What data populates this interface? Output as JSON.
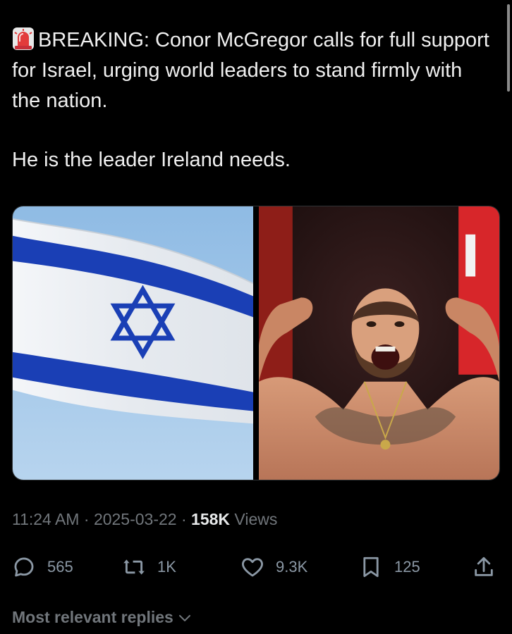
{
  "tweet": {
    "line1": "BREAKING: Conor McGregor calls for full support for Israel, urging world leaders to stand firmly with the nation.",
    "line2": "He is the leader Ireland needs."
  },
  "meta": {
    "time": "11:24 AM",
    "sep1": " · ",
    "date": "2025-03-22",
    "sep2": " · ",
    "views_count": "158K",
    "views_label": " Views"
  },
  "actions": {
    "replies": "565",
    "reposts": "1K",
    "likes": "9.3K",
    "bookmarks": "125"
  },
  "replies_sort": {
    "label": "Most relevant replies"
  },
  "icons": [
    "siren-icon",
    "reply-icon",
    "repost-icon",
    "like-icon",
    "bookmark-icon",
    "share-icon",
    "chevron-down-icon"
  ],
  "colors": {
    "background": "#000000",
    "text": "#e7e9ea",
    "secondary": "#71767b",
    "flag_blue": "#1a3fb5"
  }
}
